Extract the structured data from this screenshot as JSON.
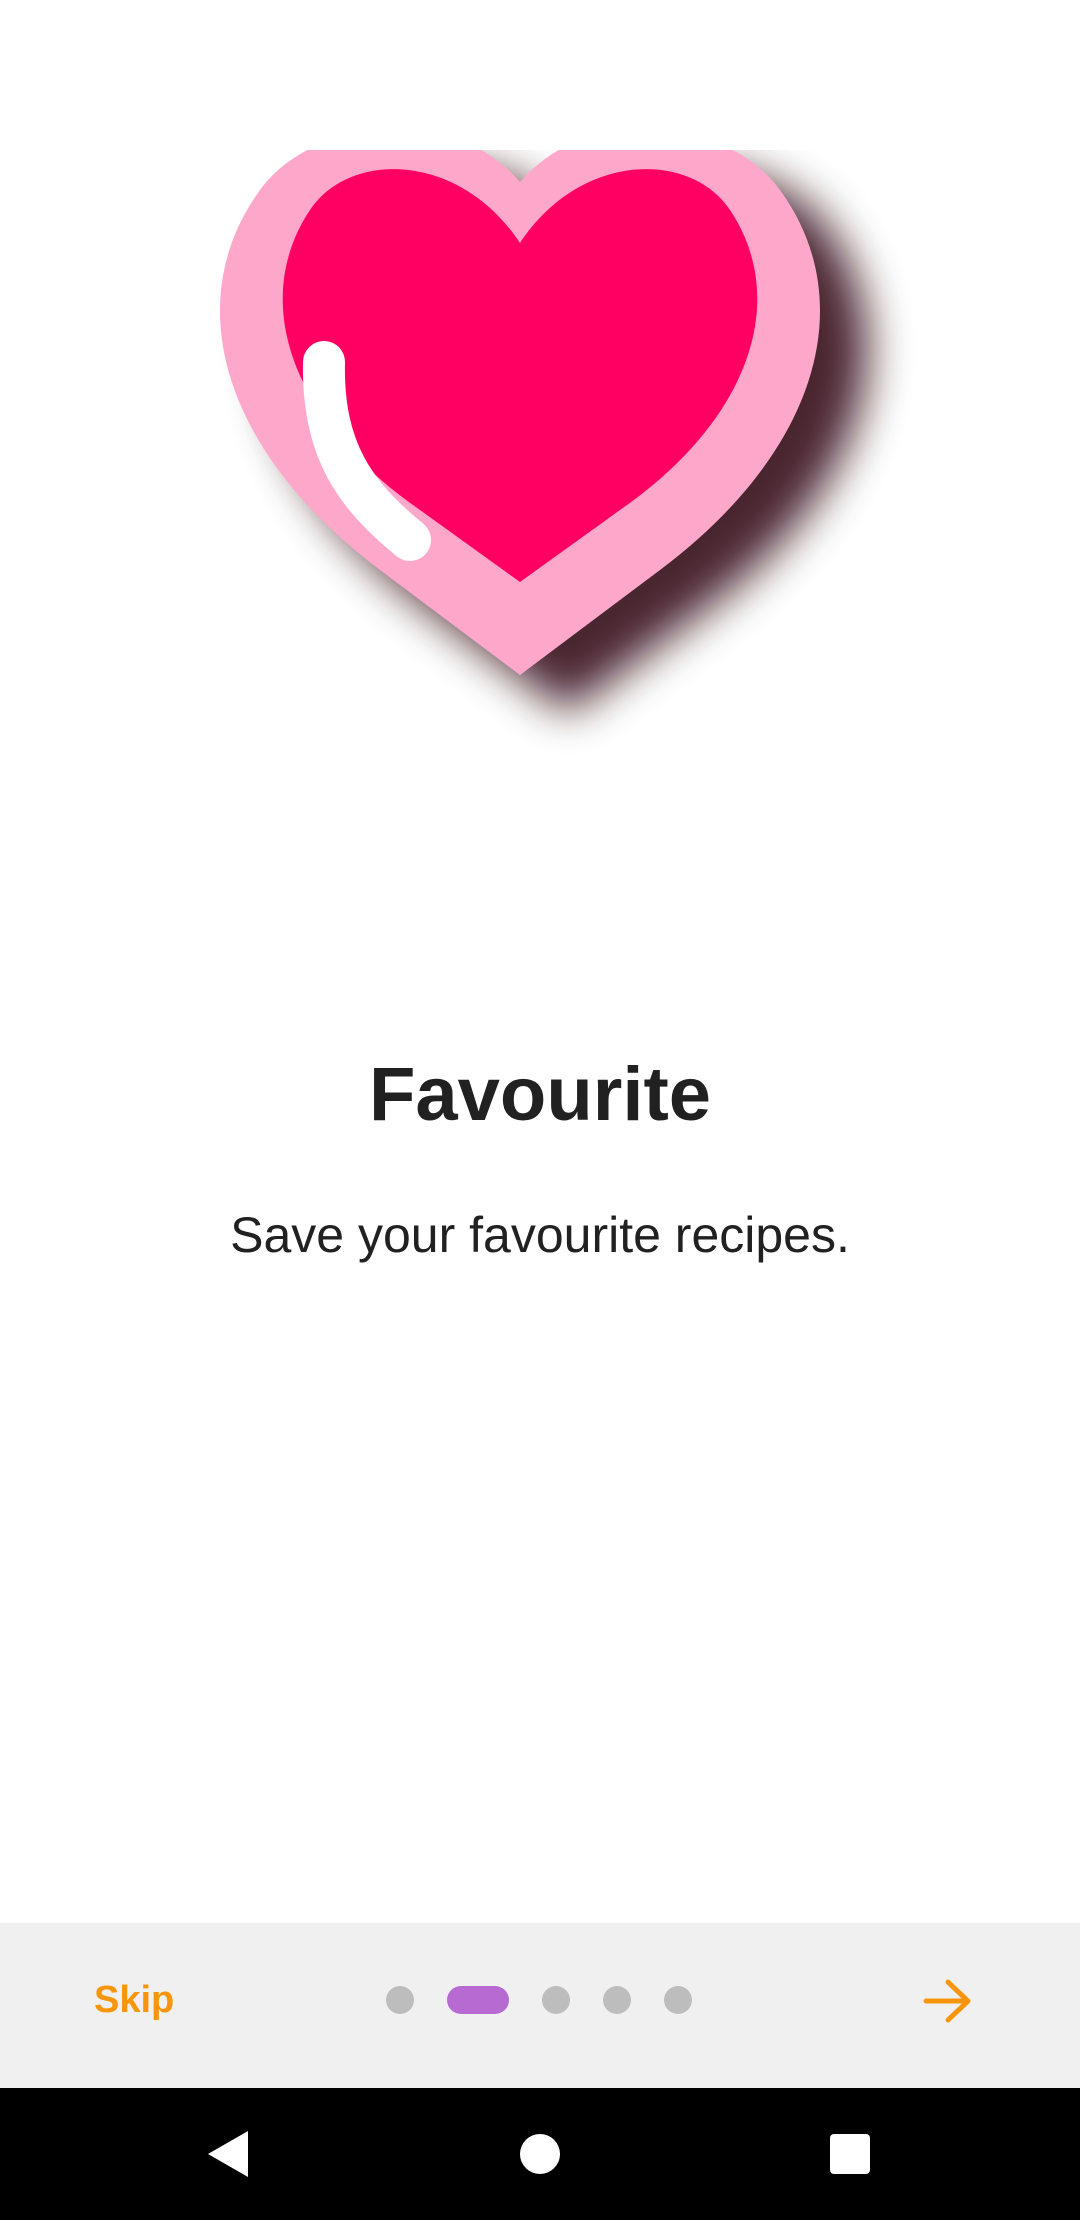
{
  "onboarding": {
    "illustration": "heart-icon",
    "title": "Favourite",
    "subtitle": "Save your favourite recipes.",
    "page_count": 5,
    "active_page_number": 2
  },
  "bottom_bar": {
    "skip_label": "Skip",
    "next_icon": "arrow-right-icon"
  },
  "navigation_bar": {
    "back_icon": "back-triangle-icon",
    "home_icon": "home-circle-icon",
    "recents_icon": "recents-square-icon"
  },
  "colors": {
    "accent": "#f7960d",
    "indicator_active": "#b76ad1",
    "indicator_inactive": "#bdbdbd",
    "heart_outer": "#fda8cb",
    "heart_inner": "#ff0062",
    "bottom_bar": "#f0f0f0"
  }
}
